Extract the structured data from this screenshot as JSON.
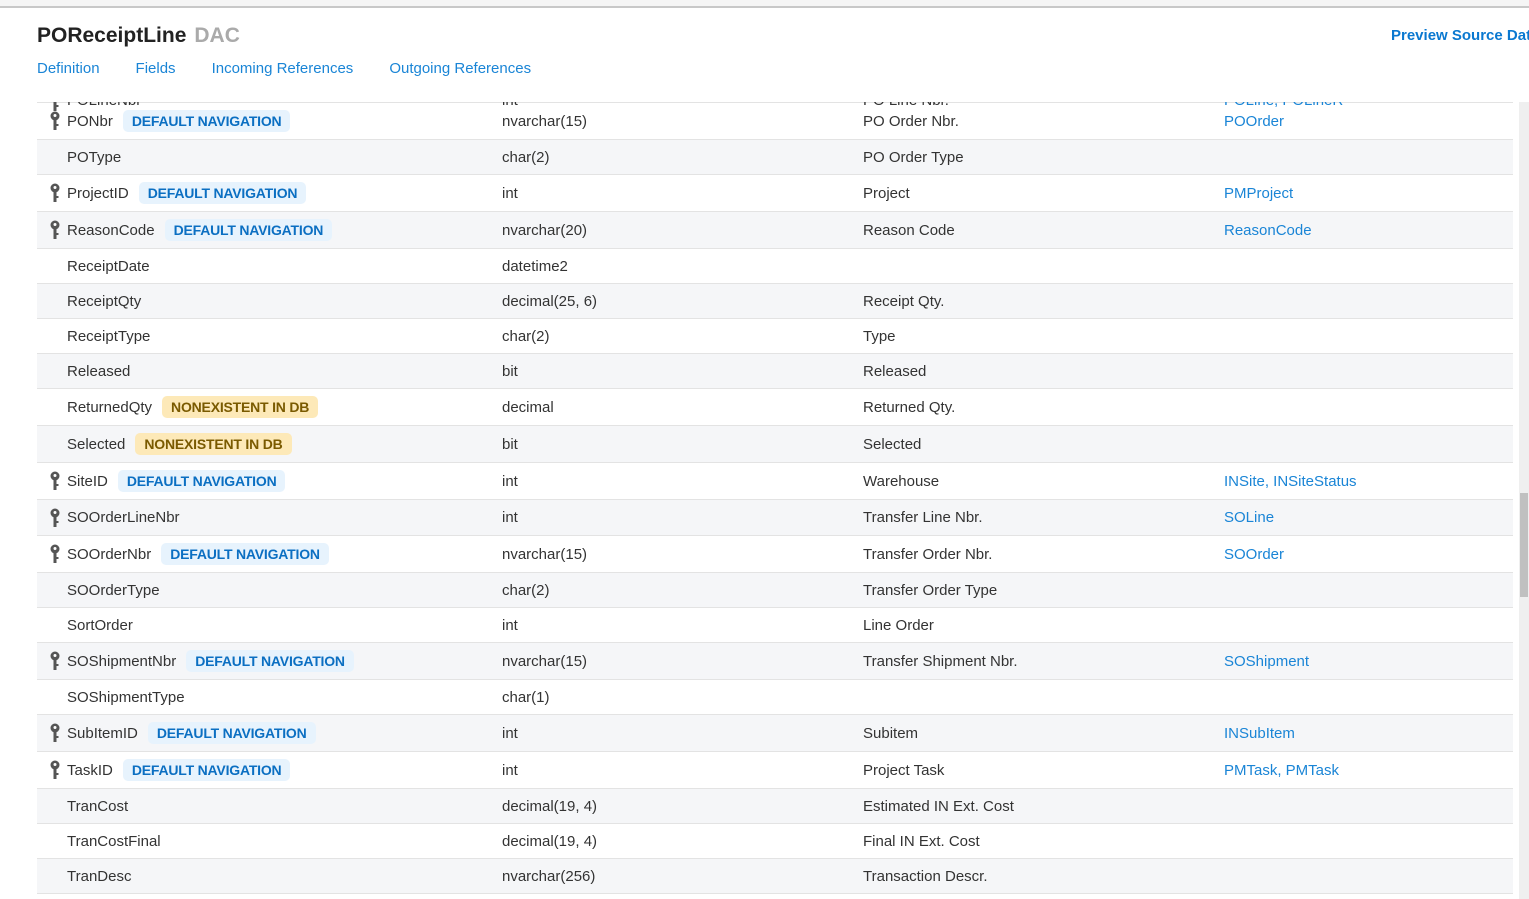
{
  "header": {
    "title": "POReceiptLine",
    "subtitle": "DAC",
    "preview_link": "Preview Source Data"
  },
  "tabs": [
    {
      "label": "Definition"
    },
    {
      "label": "Fields"
    },
    {
      "label": "Incoming References"
    },
    {
      "label": "Outgoing References"
    }
  ],
  "rows": [
    {
      "name": "POLineNbr",
      "key": true,
      "badge": "",
      "type": "int",
      "description": "PO Line Nbr.",
      "refs": "POLine, POLineR"
    },
    {
      "name": "PONbr",
      "key": true,
      "badge": "DEFAULT NAVIGATION",
      "type": "nvarchar(15)",
      "description": "PO Order Nbr.",
      "refs": "POOrder"
    },
    {
      "name": "POType",
      "key": false,
      "badge": "",
      "type": "char(2)",
      "description": "PO Order Type",
      "refs": ""
    },
    {
      "name": "ProjectID",
      "key": true,
      "badge": "DEFAULT NAVIGATION",
      "type": "int",
      "description": "Project",
      "refs": "PMProject"
    },
    {
      "name": "ReasonCode",
      "key": true,
      "badge": "DEFAULT NAVIGATION",
      "type": "nvarchar(20)",
      "description": "Reason Code",
      "refs": "ReasonCode"
    },
    {
      "name": "ReceiptDate",
      "key": false,
      "badge": "",
      "type": "datetime2",
      "description": "",
      "refs": ""
    },
    {
      "name": "ReceiptQty",
      "key": false,
      "badge": "",
      "type": "decimal(25, 6)",
      "description": "Receipt Qty.",
      "refs": ""
    },
    {
      "name": "ReceiptType",
      "key": false,
      "badge": "",
      "type": "char(2)",
      "description": "Type",
      "refs": ""
    },
    {
      "name": "Released",
      "key": false,
      "badge": "",
      "type": "bit",
      "description": "Released",
      "refs": ""
    },
    {
      "name": "ReturnedQty",
      "key": false,
      "badge": "NONEXISTENT IN DB",
      "type": "decimal",
      "description": "Returned Qty.",
      "refs": ""
    },
    {
      "name": "Selected",
      "key": false,
      "badge": "NONEXISTENT IN DB",
      "type": "bit",
      "description": "Selected",
      "refs": ""
    },
    {
      "name": "SiteID",
      "key": true,
      "badge": "DEFAULT NAVIGATION",
      "type": "int",
      "description": "Warehouse",
      "refs": "INSite, INSiteStatus"
    },
    {
      "name": "SOOrderLineNbr",
      "key": true,
      "badge": "",
      "type": "int",
      "description": "Transfer Line Nbr.",
      "refs": "SOLine"
    },
    {
      "name": "SOOrderNbr",
      "key": true,
      "badge": "DEFAULT NAVIGATION",
      "type": "nvarchar(15)",
      "description": "Transfer Order Nbr.",
      "refs": "SOOrder"
    },
    {
      "name": "SOOrderType",
      "key": false,
      "badge": "",
      "type": "char(2)",
      "description": "Transfer Order Type",
      "refs": ""
    },
    {
      "name": "SortOrder",
      "key": false,
      "badge": "",
      "type": "int",
      "description": "Line Order",
      "refs": ""
    },
    {
      "name": "SOShipmentNbr",
      "key": true,
      "badge": "DEFAULT NAVIGATION",
      "type": "nvarchar(15)",
      "description": "Transfer Shipment Nbr.",
      "refs": "SOShipment"
    },
    {
      "name": "SOShipmentType",
      "key": false,
      "badge": "",
      "type": "char(1)",
      "description": "",
      "refs": ""
    },
    {
      "name": "SubItemID",
      "key": true,
      "badge": "DEFAULT NAVIGATION",
      "type": "int",
      "description": "Subitem",
      "refs": "INSubItem"
    },
    {
      "name": "TaskID",
      "key": true,
      "badge": "DEFAULT NAVIGATION",
      "type": "int",
      "description": "Project Task",
      "refs": "PMTask, PMTask"
    },
    {
      "name": "TranCost",
      "key": false,
      "badge": "",
      "type": "decimal(19, 4)",
      "description": "Estimated IN Ext. Cost",
      "refs": ""
    },
    {
      "name": "TranCostFinal",
      "key": false,
      "badge": "",
      "type": "decimal(19, 4)",
      "description": "Final IN Ext. Cost",
      "refs": ""
    },
    {
      "name": "TranDesc",
      "key": false,
      "badge": "",
      "type": "nvarchar(256)",
      "description": "Transaction Descr.",
      "refs": ""
    }
  ],
  "colors": {
    "link": "#1a85d6",
    "nav_badge_bg": "#e7f3fd",
    "nav_badge_text": "#0b6fc2",
    "nx_badge_bg": "#fde9b8",
    "nx_badge_text": "#7a5a00"
  }
}
